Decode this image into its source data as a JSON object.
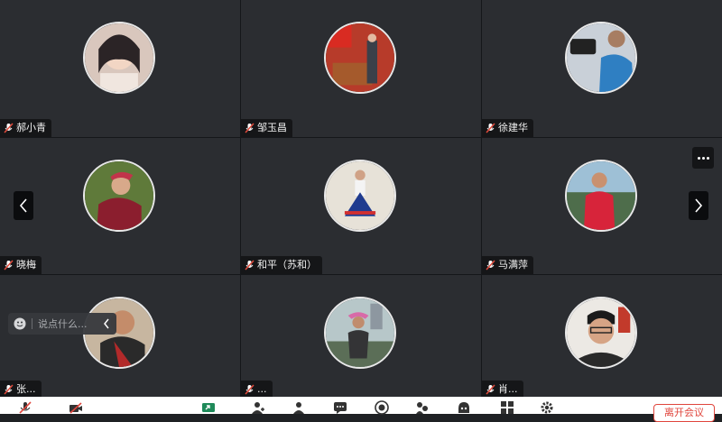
{
  "participants": [
    {
      "name": "郝小青"
    },
    {
      "name": "邹玉昌"
    },
    {
      "name": "徐建华"
    },
    {
      "name": "晓梅"
    },
    {
      "name": "和平（苏和）"
    },
    {
      "name": "马满萍"
    },
    {
      "name": "张..."
    },
    {
      "name": "..."
    },
    {
      "name": "肖..."
    }
  ],
  "chat": {
    "placeholder": "说点什么..."
  },
  "toolbar": {
    "end_label": "离开会议"
  },
  "colors": {
    "end_button": "#e0463d",
    "tile_bg": "#2b2d31"
  }
}
